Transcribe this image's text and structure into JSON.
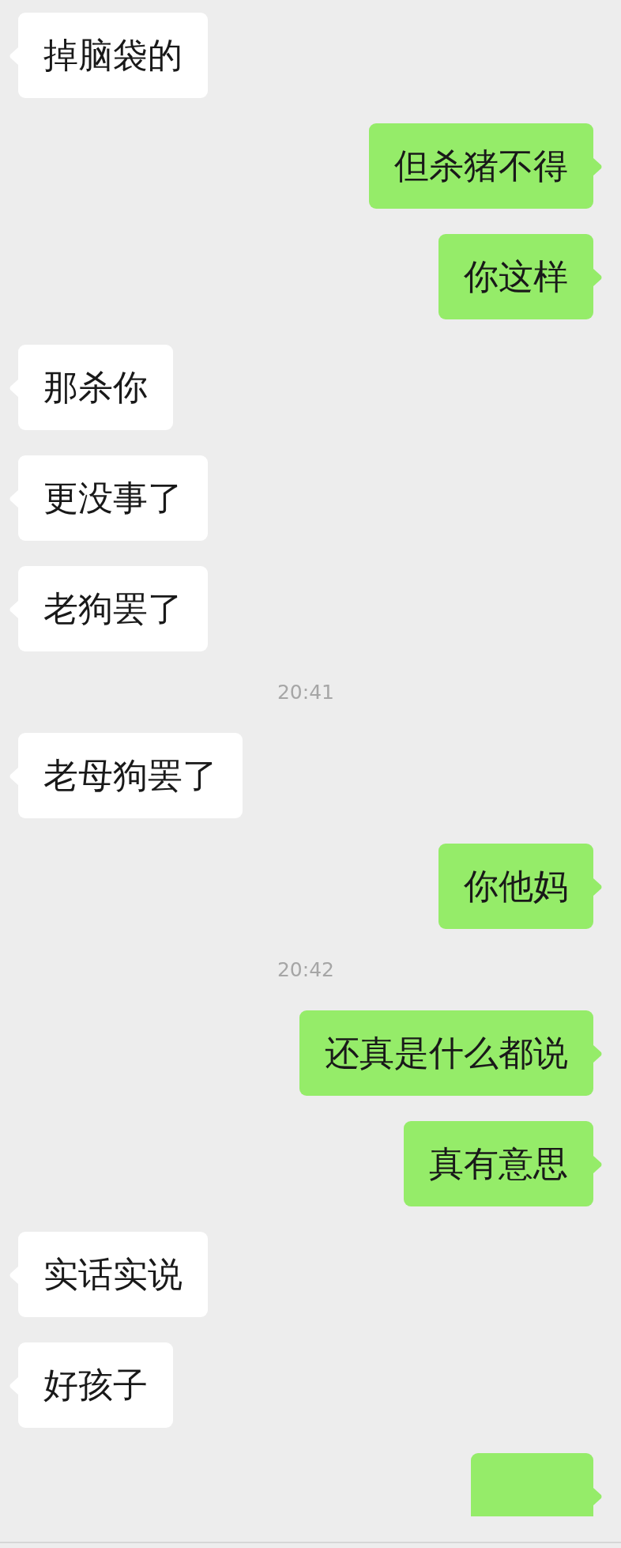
{
  "messages": [
    {
      "kind": "message",
      "outgoing": false,
      "text": "掉脑袋的"
    },
    {
      "kind": "message",
      "outgoing": true,
      "text": "但杀猪不得"
    },
    {
      "kind": "message",
      "outgoing": true,
      "text": "你这样"
    },
    {
      "kind": "message",
      "outgoing": false,
      "text": "那杀你"
    },
    {
      "kind": "message",
      "outgoing": false,
      "text": "更没事了"
    },
    {
      "kind": "message",
      "outgoing": false,
      "text": "老狗罢了"
    },
    {
      "kind": "time",
      "text": "20:41"
    },
    {
      "kind": "message",
      "outgoing": false,
      "text": "老母狗罢了"
    },
    {
      "kind": "message",
      "outgoing": true,
      "text": "你他妈"
    },
    {
      "kind": "time",
      "text": "20:42"
    },
    {
      "kind": "message",
      "outgoing": true,
      "text": "还真是什么都说"
    },
    {
      "kind": "message",
      "outgoing": true,
      "text": "真有意思"
    },
    {
      "kind": "message",
      "outgoing": false,
      "text": "实话实说"
    },
    {
      "kind": "message",
      "outgoing": false,
      "text": "好孩子"
    },
    {
      "kind": "cut_off",
      "outgoing": true
    }
  ]
}
